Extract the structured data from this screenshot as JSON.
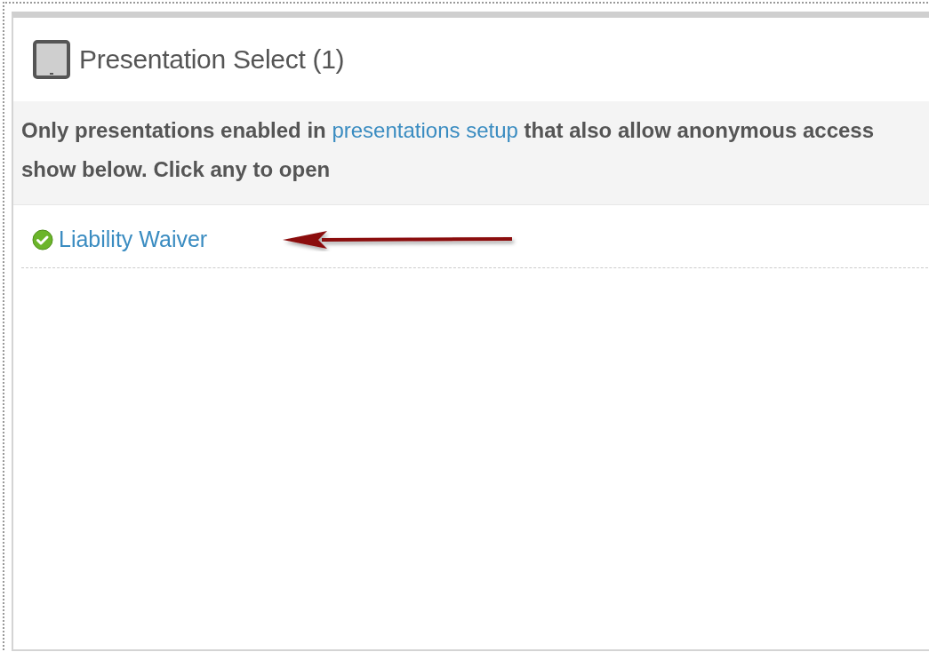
{
  "panel": {
    "title": "Presentation Select (1)"
  },
  "notice": {
    "before": "Only presentations enabled in",
    "link": "presentations setup",
    "after": "that also allow anonymous access show below. Click any to open"
  },
  "presentations": [
    {
      "label": "Liability Waiver",
      "kind": "ok",
      "arrow": true
    }
  ]
}
